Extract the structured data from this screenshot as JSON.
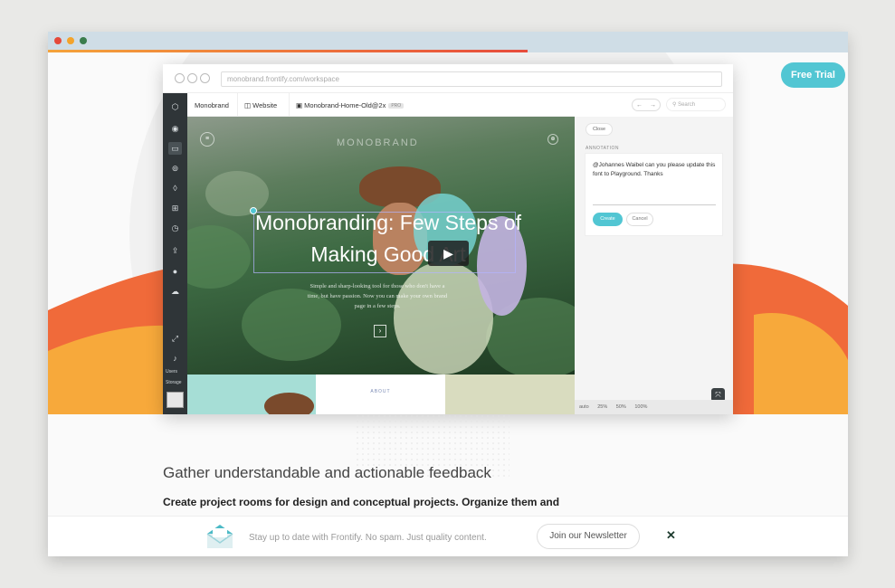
{
  "browser": {
    "free_trial": "Free Trial"
  },
  "app": {
    "url": "monobrand.frontify.com/workspace",
    "breadcrumbs": [
      "Monobrand",
      "Website",
      "Monobrand-Home-Old@2x"
    ],
    "badge": "PRO",
    "search_placeholder": "Search",
    "sidebar_labels": {
      "users": "Users",
      "storage": "Storage"
    },
    "hero": {
      "logo": "MONOBRAND",
      "title": "Monobranding: Few Steps of Making Good Art",
      "subtitle": "Simple and sharp-looking tool for those who don't have a time, but have passion. Now you can make your own brand page in a few steps."
    },
    "strip": {
      "about": "ABOUT"
    },
    "panel": {
      "close": "Close",
      "annotation_label": "ANNOTATION",
      "annotation_text": "@Johannes Waibel can you please update this font to Playground. Thanks",
      "create": "Create",
      "cancel": "Cancel",
      "zoom": [
        "auto",
        "25%",
        "50%",
        "100%"
      ]
    }
  },
  "content": {
    "heading": "Gather understandable and actionable feedback",
    "subtext": "Create project rooms for design and conceptual projects. Organize them and"
  },
  "newsletter": {
    "text": "Stay up to date with Frontify. No spam. Just quality content.",
    "button": "Join our Newsletter",
    "close": "✕"
  },
  "colors": {
    "accent": "#52c6d3",
    "sidebar": "#2f3538",
    "swoosh_orange": "#f06a3a",
    "swoosh_yellow": "#f7a93b"
  }
}
